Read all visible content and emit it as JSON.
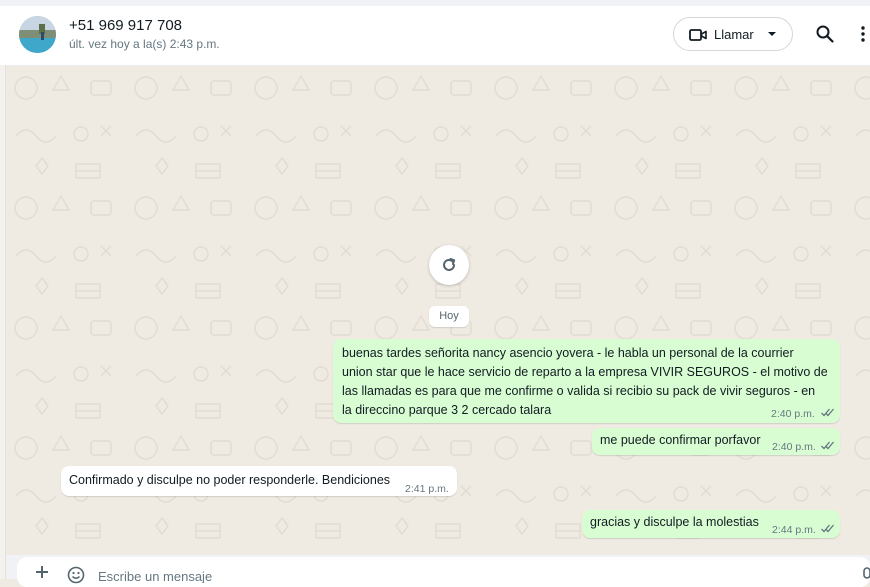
{
  "header": {
    "contact_name": "+51 969 917 708",
    "last_seen": "últ. vez hoy a la(s) 2:43 p.m.",
    "call_label": "Llamar",
    "icons": [
      "video-icon",
      "chevron-down-icon",
      "search-icon",
      "menu-icon"
    ]
  },
  "chat": {
    "date_label": "Hoy",
    "messages": [
      {
        "direction": "out",
        "lines": [
          "buenas tardes señorita nancy asencio yovera - le habla un personal de la courrier",
          "union star que le hace servicio de reparto a la empresa VIVIR SEGUROS - el motivo de",
          "las llamadas es para que me confirme o valida si recibio su pack de vivir seguros - en",
          "la direccino parque 3 2 cercado talara"
        ],
        "time": "2:40 p.m.",
        "status": "read"
      },
      {
        "direction": "out",
        "text": "me puede confirmar porfavor",
        "time": "2:40 p.m.",
        "status": "read"
      },
      {
        "direction": "in",
        "text": "Confirmado y disculpe no poder responderle. Bendiciones",
        "time": "2:41 p.m."
      },
      {
        "direction": "out",
        "text": "gracias y disculpe la molestias",
        "time": "2:44 p.m.",
        "status": "read"
      }
    ]
  },
  "composer": {
    "placeholder": "Escribe un mensaje"
  },
  "colors": {
    "outgoing_bubble": "#d9fdd3",
    "incoming_bubble": "#ffffff",
    "chat_background": "#efeae2",
    "read_ticks": "#667781"
  }
}
